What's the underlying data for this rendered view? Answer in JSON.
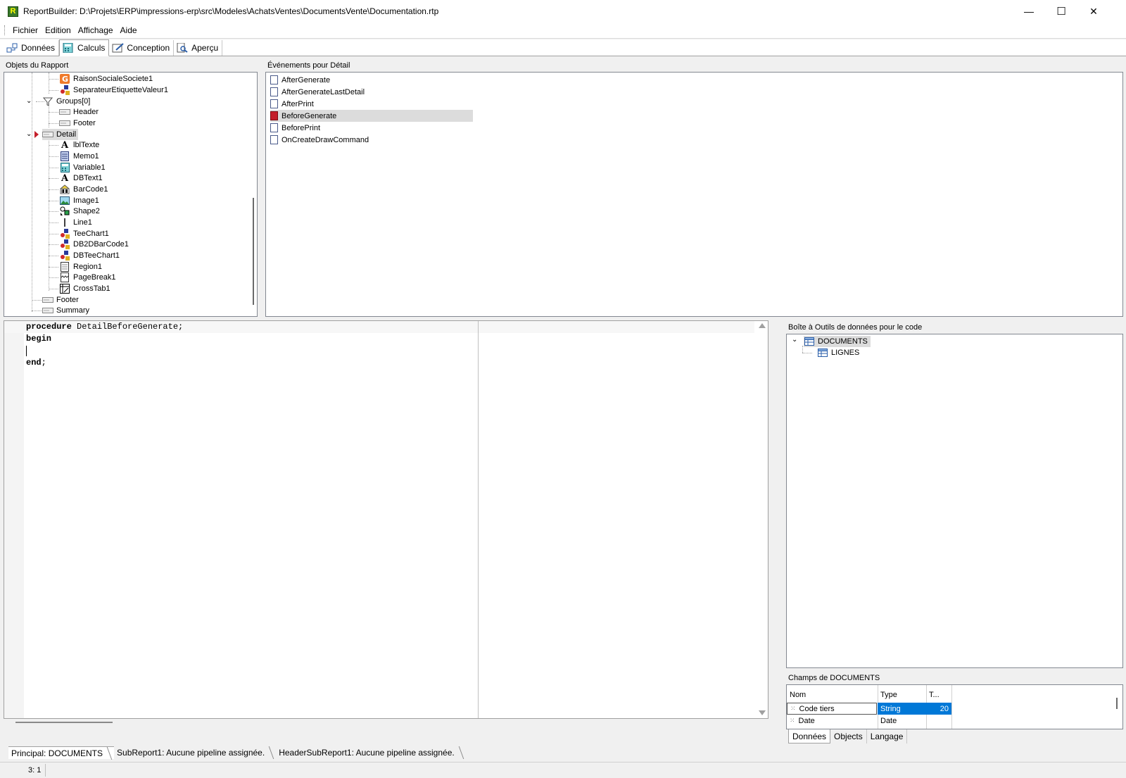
{
  "window": {
    "title": "ReportBuilder: D:\\Projets\\ERP\\impressions-erp\\src\\Modeles\\AchatsVentes\\DocumentsVente\\Documentation.rtp",
    "icon_letter": "R",
    "minimize": "—",
    "maximize": "☐",
    "close": "✕"
  },
  "menu": {
    "items": [
      "Fichier",
      "Edition",
      "Affichage",
      "Aide"
    ]
  },
  "main_tabs": [
    {
      "label": "Données",
      "icon": "data-icon"
    },
    {
      "label": "Calculs",
      "icon": "calc-icon",
      "active": true
    },
    {
      "label": "Conception",
      "icon": "design-icon"
    },
    {
      "label": "Aperçu",
      "icon": "preview-icon"
    }
  ],
  "objects_panel": {
    "label": "Objets du Rapport",
    "items": [
      {
        "label": "RaisonSocialeSociete1",
        "icon": "g-icon"
      },
      {
        "label": "SeparateurEtiquetteValeur1",
        "icon": "shapes-icon"
      },
      {
        "label": "Groups[0]",
        "icon": "group-icon"
      },
      {
        "label": "Header",
        "icon": "band-icon"
      },
      {
        "label": "Footer",
        "icon": "band-icon"
      },
      {
        "label": "Detail",
        "icon": "band-icon"
      },
      {
        "label": "lblTexte",
        "icon": "label-icon"
      },
      {
        "label": "Memo1",
        "icon": "memo-icon"
      },
      {
        "label": "Variable1",
        "icon": "variable-icon"
      },
      {
        "label": "DBText1",
        "icon": "dbtext-icon"
      },
      {
        "label": "BarCode1",
        "icon": "barcode-icon"
      },
      {
        "label": "Image1",
        "icon": "image-icon"
      },
      {
        "label": "Shape2",
        "icon": "shape-icon"
      },
      {
        "label": "Line1",
        "icon": "line-icon"
      },
      {
        "label": "TeeChart1",
        "icon": "shapes-icon"
      },
      {
        "label": "DB2DBarCode1",
        "icon": "shapes-icon"
      },
      {
        "label": "DBTeeChart1",
        "icon": "shapes-icon"
      },
      {
        "label": "Region1",
        "icon": "region-icon"
      },
      {
        "label": "PageBreak1",
        "icon": "pagebreak-icon"
      },
      {
        "label": "CrossTab1",
        "icon": "crosstab-icon"
      },
      {
        "label": "Footer",
        "icon": "band-icon"
      },
      {
        "label": "Summary",
        "icon": "band-icon"
      }
    ]
  },
  "events_panel": {
    "label": "Événements pour Détail",
    "items": [
      "AfterGenerate",
      "AfterGenerateLastDetail",
      "AfterPrint",
      "BeforeGenerate",
      "BeforePrint",
      "OnCreateDrawCommand"
    ],
    "selected_index": 3
  },
  "code": {
    "lines": [
      {
        "kw": "procedure",
        "rest": " DetailBeforeGenerate;"
      },
      {
        "kw": "begin",
        "rest": ""
      },
      {
        "kw": "",
        "rest": ""
      },
      {
        "kw": "end",
        "rest": ";"
      }
    ]
  },
  "toolbox": {
    "label": "Boîte à Outils de données pour le code",
    "tree": [
      {
        "label": "DOCUMENTS",
        "icon": "table-icon"
      },
      {
        "label": "LIGNES",
        "icon": "table-icon"
      }
    ]
  },
  "fields": {
    "label": "Champs de DOCUMENTS",
    "columns": [
      "Nom",
      "Type",
      "T..."
    ],
    "rows": [
      {
        "name": "Code tiers",
        "type": "String",
        "size": "20"
      },
      {
        "name": "Date",
        "type": "Date",
        "size": ""
      }
    ]
  },
  "toolbox_tabs": [
    "Données",
    "Objects",
    "Langage"
  ],
  "report_tabs": [
    "Principal: DOCUMENTS",
    "SubReport1: Aucune pipeline assignée.",
    "HeaderSubReport1: Aucune pipeline assignée."
  ],
  "status": {
    "position": "3: 1"
  },
  "colors": {
    "selection": "#0078d7",
    "selected_row": "#dcdcdc"
  }
}
